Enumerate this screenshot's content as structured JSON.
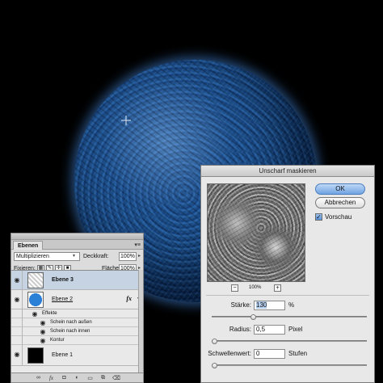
{
  "layers_panel": {
    "tab_label": "Ebenen",
    "blend_mode": "Multiplizieren",
    "opacity_label": "Deckkraft:",
    "opacity_value": "100%",
    "lock_label": "Fixieren:",
    "fill_label": "Fläche:",
    "fill_value": "100%",
    "layers": [
      {
        "name": "Ebene 3"
      },
      {
        "name": "Ebene 2",
        "fx": "fx"
      },
      {
        "name": "Ebene 1"
      }
    ],
    "effects_label": "Effekte",
    "effects": [
      "Schein nach außen",
      "Schein nach innen",
      "Kontur"
    ],
    "footer_icons": [
      "link-icon",
      "fx-icon",
      "mask-icon",
      "adjustment-icon",
      "folder-icon",
      "new-layer-icon",
      "trash-icon"
    ]
  },
  "dialog": {
    "title": "Unscharf maskieren",
    "ok_label": "OK",
    "cancel_label": "Abbrechen",
    "preview_label": "Vorschau",
    "preview_checked": true,
    "zoom_value": "100%",
    "zoom_out": "−",
    "zoom_in": "+",
    "amount_label": "Stärke:",
    "amount_value": "130",
    "amount_unit": "%",
    "radius_label": "Radius:",
    "radius_value": "0,5",
    "radius_unit": "Pixel",
    "threshold_label": "Schwellenwert:",
    "threshold_value": "0",
    "threshold_unit": "Stufen",
    "amount_slider": 0.26,
    "radius_slider": 0.0,
    "threshold_slider": 0.0
  },
  "colors": {
    "planet_blue": "#1a4f8a",
    "glow": "#468ce6",
    "active_layer": "#c6d3e3",
    "ok_button": "#6fa3e2"
  }
}
